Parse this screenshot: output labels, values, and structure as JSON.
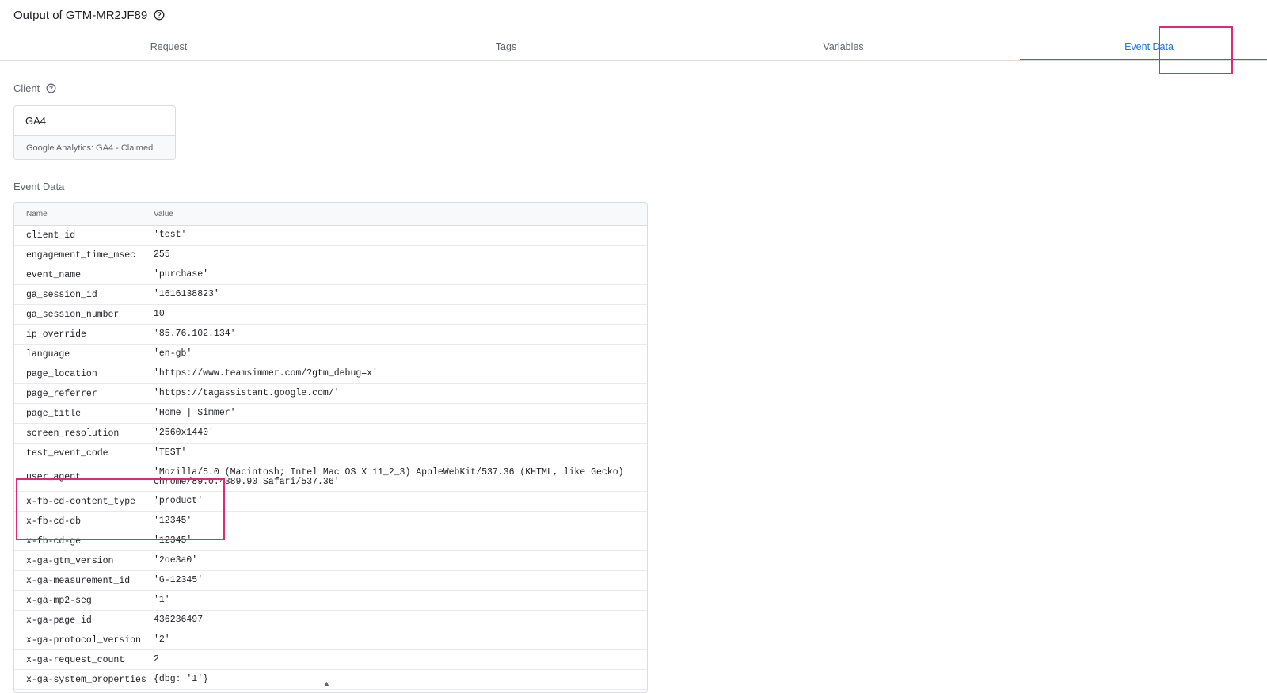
{
  "header": {
    "title": "Output of GTM-MR2JF89"
  },
  "tabs": [
    {
      "label": "Request"
    },
    {
      "label": "Tags"
    },
    {
      "label": "Variables"
    },
    {
      "label": "Event Data"
    }
  ],
  "active_tab": "Event Data",
  "client_section": {
    "label": "Client",
    "name": "GA4",
    "description": "Google Analytics: GA4 - Claimed"
  },
  "event_data_section": {
    "label": "Event Data",
    "columns": {
      "name": "Name",
      "value": "Value"
    },
    "rows": [
      {
        "name": "client_id",
        "value": "'test'"
      },
      {
        "name": "engagement_time_msec",
        "value": "255"
      },
      {
        "name": "event_name",
        "value": "'purchase'"
      },
      {
        "name": "ga_session_id",
        "value": "'1616138823'"
      },
      {
        "name": "ga_session_number",
        "value": "10"
      },
      {
        "name": "ip_override",
        "value": "'85.76.102.134'"
      },
      {
        "name": "language",
        "value": "'en-gb'"
      },
      {
        "name": "page_location",
        "value": "'https://www.teamsimmer.com/?gtm_debug=x'"
      },
      {
        "name": "page_referrer",
        "value": "'https://tagassistant.google.com/'"
      },
      {
        "name": "page_title",
        "value": "'Home | Simmer'"
      },
      {
        "name": "screen_resolution",
        "value": "'2560x1440'"
      },
      {
        "name": "test_event_code",
        "value": "'TEST'"
      },
      {
        "name": "user_agent",
        "value": "'Mozilla/5.0 (Macintosh; Intel Mac OS X 11_2_3) AppleWebKit/537.36 (KHTML, like Gecko) Chrome/89.0.4389.90 Safari/537.36'"
      },
      {
        "name": "x-fb-cd-content_type",
        "value": "'product'"
      },
      {
        "name": "x-fb-cd-db",
        "value": "'12345'"
      },
      {
        "name": "x-fb-cd-ge",
        "value": "'12345'"
      },
      {
        "name": "x-ga-gtm_version",
        "value": "'2oe3a0'"
      },
      {
        "name": "x-ga-measurement_id",
        "value": "'G-12345'"
      },
      {
        "name": "x-ga-mp2-seg",
        "value": "'1'"
      },
      {
        "name": "x-ga-page_id",
        "value": "436236497"
      },
      {
        "name": "x-ga-protocol_version",
        "value": "'2'"
      },
      {
        "name": "x-ga-request_count",
        "value": "2"
      },
      {
        "name": "x-ga-system_properties",
        "value": "{dbg: '1'}"
      }
    ]
  },
  "icons": {
    "help": "help-circle-icon"
  },
  "colors": {
    "accent": "#1a73e8",
    "highlight": "#e0296f"
  }
}
